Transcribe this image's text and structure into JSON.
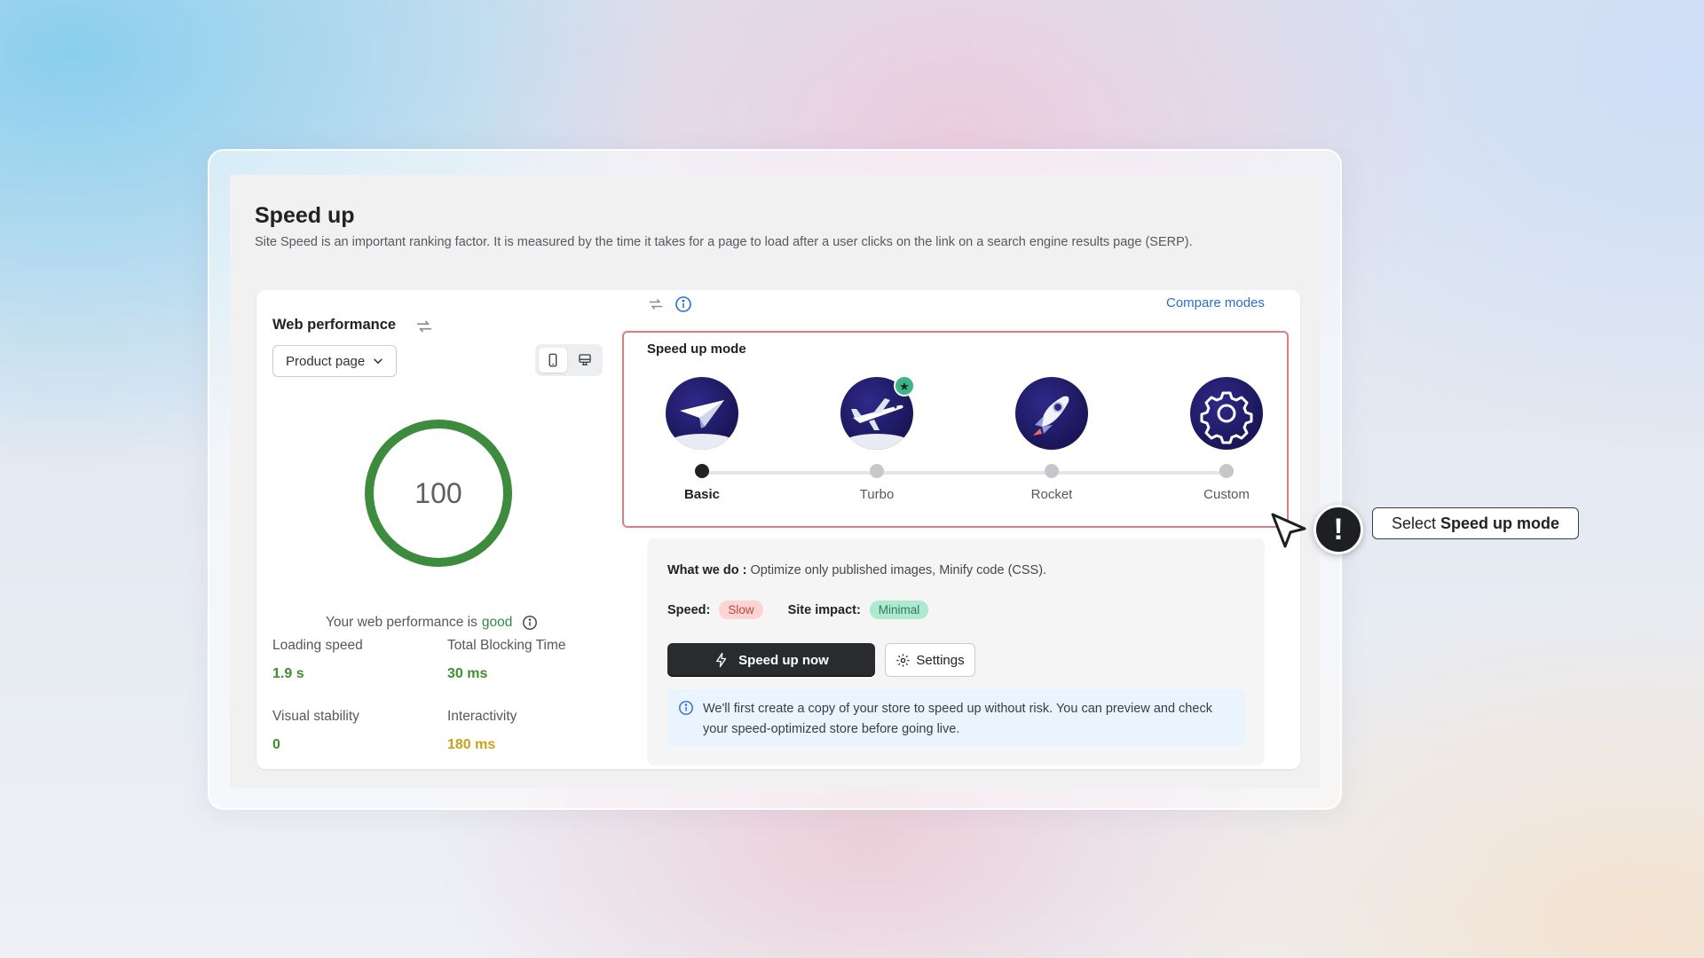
{
  "header": {
    "title": "Speed up",
    "subtitle": "Site Speed is an important ranking factor. It is measured by the time it takes for a page to load after a user clicks on the link on a search engine results page (SERP)."
  },
  "web_performance": {
    "title": "Web performance",
    "page_select": "Product page",
    "device_active": "mobile",
    "score": "100",
    "score_fraction": 1.0,
    "status_prefix": "Your web performance is",
    "status_value": "good",
    "metrics": [
      {
        "label": "Loading speed",
        "value": "1.9 s",
        "color": "#3f8f2c"
      },
      {
        "label": "Total Blocking Time",
        "value": "30 ms",
        "color": "#3f8f2c"
      },
      {
        "label": "Visual stability",
        "value": "0",
        "color": "#3f8f2c"
      },
      {
        "label": "Interactivity",
        "value": "180 ms",
        "color": "#c9a11c"
      }
    ]
  },
  "compare_link": "Compare modes",
  "speed_up_mode": {
    "title": "Speed up mode",
    "selected": "Basic",
    "modes": [
      {
        "label": "Basic",
        "icon": "paper-plane-icon",
        "active": true
      },
      {
        "label": "Turbo",
        "icon": "airplane-icon",
        "recommended": true
      },
      {
        "label": "Rocket",
        "icon": "rocket-icon"
      },
      {
        "label": "Custom",
        "icon": "gear-icon"
      }
    ]
  },
  "details": {
    "what_we_do_label": "What we do :",
    "what_we_do_text": "Optimize only published images, Minify code (CSS).",
    "speed_label": "Speed:",
    "speed_value": "Slow",
    "impact_label": "Site impact:",
    "impact_value": "Minimal",
    "primary_button": "Speed up now",
    "settings_button": "Settings",
    "info_text": "We'll first create a copy of your store to speed up without risk. You can preview and check your speed-optimized store before going live."
  },
  "callout": {
    "prefix": "Select",
    "emphasis": "Speed up mode"
  },
  "colors": {
    "accent_border": "#e07b7f",
    "score_ring": "#3d8b3d",
    "link": "#2c6ecb",
    "primary_button": "#2a2b2e"
  }
}
